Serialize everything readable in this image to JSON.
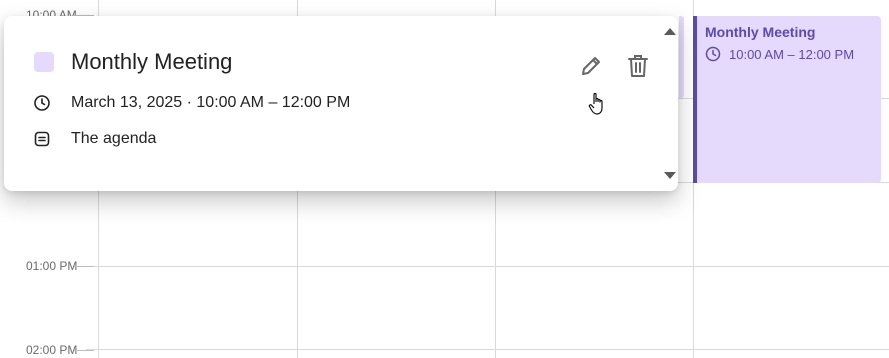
{
  "calendar": {
    "time_labels": [
      "10:00 AM",
      "01:00 PM",
      "02:00 PM"
    ]
  },
  "event": {
    "title": "Monthly Meeting",
    "time": "10:00 AM – 12:00 PM",
    "color": "#e5d9fc",
    "accent": "#5b4bab"
  },
  "popover": {
    "title": "Monthly Meeting",
    "datetime": "March 13, 2025 · 10:00 AM – 12:00 PM",
    "description": "The agenda",
    "icons": {
      "time": "clock-icon",
      "description": "notes-icon",
      "edit": "pencil-icon",
      "delete": "trash-icon"
    }
  }
}
